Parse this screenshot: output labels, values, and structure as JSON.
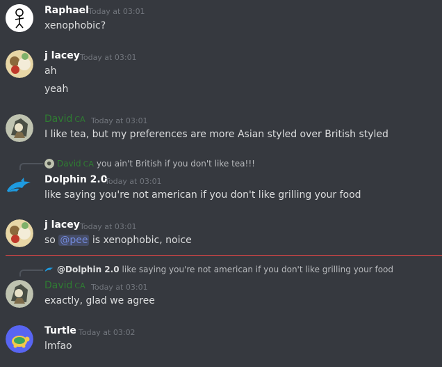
{
  "messages": [
    {
      "author": "Raphael",
      "time": "Today at 03:01",
      "lines": [
        "xenophobic?"
      ]
    },
    {
      "author": "j lacey",
      "time": "Today at 03:01",
      "lines": [
        "ah",
        "yeah"
      ]
    },
    {
      "author": "David",
      "tag": "CA",
      "time": "Today at 03:01",
      "lines": [
        "I like tea, but my preferences are more Asian styled over British styled"
      ]
    },
    {
      "author": "Dolphin 2.0",
      "time": "Today at 03:01",
      "reply": {
        "author": "David",
        "tag": "CA",
        "text": "you ain't British if you don't like tea!!!"
      },
      "lines": [
        "like saying you're not american if you don't like grilling your food"
      ]
    },
    {
      "author": "j lacey",
      "time": "Today at 03:01",
      "line_prefix": "so",
      "mention": "@pee",
      "line_suffix": "is xenophobic, noice"
    },
    {
      "author": "David",
      "tag": "CA",
      "time": "Today at 03:01",
      "reply": {
        "author": "@Dolphin 2.0",
        "text": "like saying you're not american if you don't like grilling your food"
      },
      "lines": [
        "exactly, glad we agree"
      ]
    },
    {
      "author": "Turtle",
      "time": "Today at 03:02",
      "lines": [
        "lmfao"
      ]
    }
  ],
  "colors": {
    "background": "#36393f",
    "role_green": "#2f7d32",
    "mention": "#7289da",
    "new_divider": "#f04747"
  },
  "icons": [
    "raphael-avatar",
    "jlacey-avatar",
    "david-avatar",
    "dolphin-icon",
    "turtle-avatar"
  ]
}
